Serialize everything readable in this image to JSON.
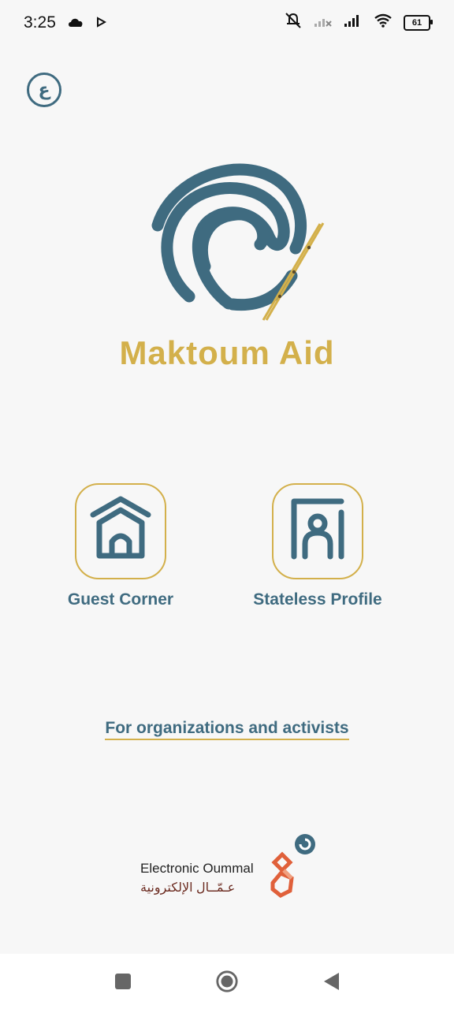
{
  "status_bar": {
    "time": "3:25",
    "battery": "61",
    "icons": [
      "cloud-icon",
      "play-icon",
      "mute-icon",
      "signal-x-icon",
      "signal-icon",
      "wifi-icon",
      "battery-icon"
    ]
  },
  "lang_toggle": {
    "label": "ع",
    "icon": "arabic-letter-icon"
  },
  "app": {
    "title": "Maktoum Aid"
  },
  "actions": [
    {
      "label": "Guest Corner",
      "icon": "house-icon"
    },
    {
      "label": "Stateless Profile",
      "icon": "person-frame-icon"
    }
  ],
  "org_link": {
    "label": "For organizations and activists"
  },
  "brand": {
    "name_en": "Electronic Oummal",
    "name_ar": "عـمّــال الإلكترونية"
  },
  "colors": {
    "primary": "#3f6b80",
    "accent": "#d3b04b",
    "background": "#f7f7f7"
  },
  "nav": [
    "recents-button",
    "home-button",
    "back-button"
  ]
}
